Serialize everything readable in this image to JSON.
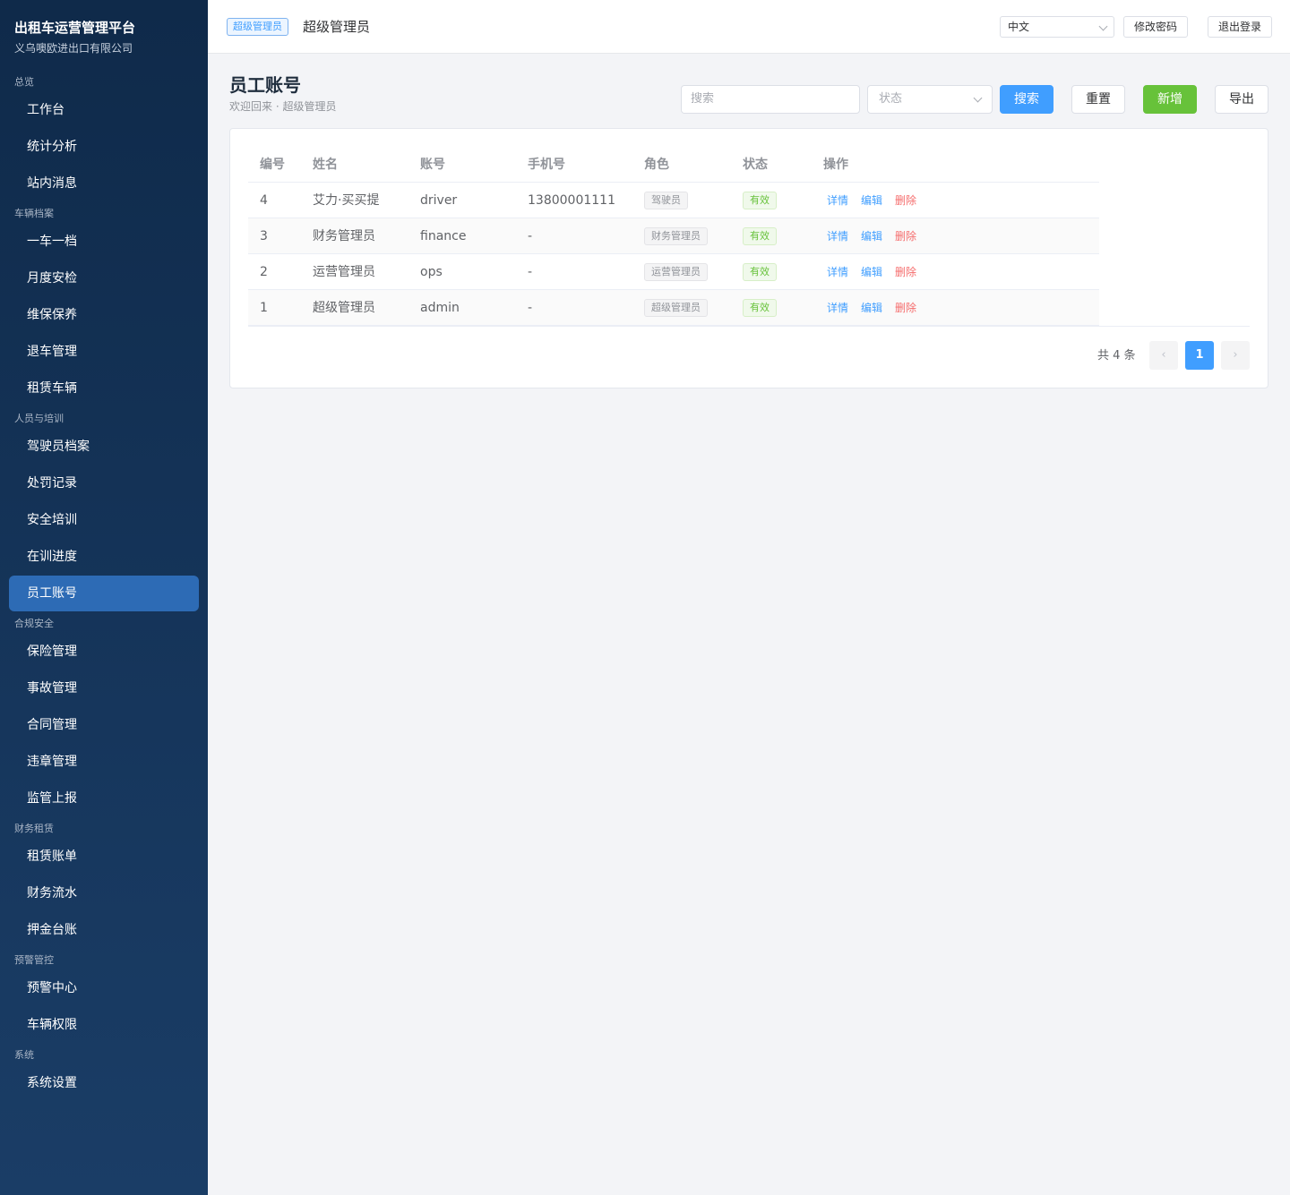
{
  "brand": {
    "title": "出租车运营管理平台",
    "subtitle": "义乌噢欧进出口有限公司"
  },
  "sidebar": {
    "groups": [
      {
        "title": "总览",
        "items": [
          "工作台",
          "统计分析",
          "站内消息"
        ]
      },
      {
        "title": "车辆档案",
        "items": [
          "一车一档",
          "月度安检",
          "维保保养",
          "退车管理",
          "租赁车辆"
        ]
      },
      {
        "title": "人员与培训",
        "items": [
          "驾驶员档案",
          "处罚记录",
          "安全培训",
          "在训进度",
          "员工账号"
        ]
      },
      {
        "title": "合规安全",
        "items": [
          "保险管理",
          "事故管理",
          "合同管理",
          "违章管理",
          "监管上报"
        ]
      },
      {
        "title": "财务租赁",
        "items": [
          "租赁账单",
          "财务流水",
          "押金台账"
        ]
      },
      {
        "title": "预警管控",
        "items": [
          "预警中心",
          "车辆权限"
        ]
      },
      {
        "title": "系统",
        "items": [
          "系统设置"
        ]
      }
    ],
    "active_item": "员工账号"
  },
  "header": {
    "role_tag": "超级管理员",
    "user_name": "超级管理员",
    "language": "中文",
    "change_password": "修改密码",
    "logout": "退出登录"
  },
  "page": {
    "title": "员工账号",
    "subtitle": "欢迎回来 · 超级管理员"
  },
  "toolbar": {
    "search_placeholder": "搜索",
    "status_placeholder": "状态",
    "search_btn": "搜索",
    "reset_btn": "重置",
    "add_btn": "新增",
    "export_btn": "导出"
  },
  "table": {
    "columns": [
      "编号",
      "姓名",
      "账号",
      "手机号",
      "角色",
      "状态",
      "操作"
    ],
    "rows": [
      {
        "id": "4",
        "name": "艾力·买买提",
        "account": "driver",
        "phone": "13800001111",
        "role": "驾驶员",
        "status": "有效"
      },
      {
        "id": "3",
        "name": "财务管理员",
        "account": "finance",
        "phone": "-",
        "role": "财务管理员",
        "status": "有效"
      },
      {
        "id": "2",
        "name": "运营管理员",
        "account": "ops",
        "phone": "-",
        "role": "运营管理员",
        "status": "有效"
      },
      {
        "id": "1",
        "name": "超级管理员",
        "account": "admin",
        "phone": "-",
        "role": "超级管理员",
        "status": "有效"
      }
    ],
    "actions": {
      "detail": "详情",
      "edit": "编辑",
      "delete": "删除"
    }
  },
  "pagination": {
    "total_text": "共 4 条",
    "current_page": "1",
    "prev_icon": "‹",
    "next_icon": "›"
  },
  "colors": {
    "sidebar_bg": "#0f2a4a",
    "active_item": "#2d6bb5",
    "primary": "#409eff",
    "success": "#67c23a",
    "danger": "#f56c6c"
  }
}
